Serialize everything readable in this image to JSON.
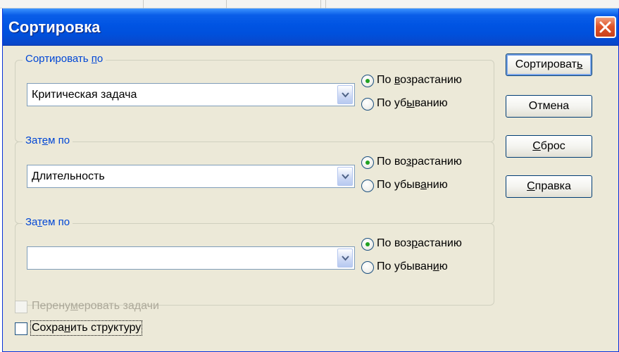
{
  "window": {
    "title": "Сортировка"
  },
  "groups": [
    {
      "label_parts": [
        "Сортировать ",
        "п",
        "о"
      ],
      "value": "Критическая задача",
      "asc_parts": [
        "По ",
        "в",
        "озрастанию"
      ],
      "desc_parts": [
        "По уб",
        "ы",
        "ванию"
      ],
      "selected": "asc"
    },
    {
      "label_parts": [
        "Зат",
        "е",
        "м по"
      ],
      "value": "Длительность",
      "asc_parts": [
        "По во",
        "з",
        "растанию"
      ],
      "desc_parts": [
        "По убыв",
        "а",
        "нию"
      ],
      "selected": "asc"
    },
    {
      "label_parts": [
        "За",
        "т",
        "ем по"
      ],
      "value": "",
      "asc_parts": [
        "По воз",
        "р",
        "астанию"
      ],
      "desc_parts": [
        "По убыван",
        "и",
        "ю"
      ],
      "selected": "asc"
    }
  ],
  "buttons": {
    "sort": [
      "Сортироват",
      "ь",
      ""
    ],
    "cancel": [
      "",
      "",
      "Отмена"
    ],
    "reset": [
      "",
      "С",
      "брос"
    ],
    "help": [
      "",
      "С",
      "правка"
    ]
  },
  "checkboxes": {
    "renumber": {
      "parts": [
        "Перену",
        "м",
        "еровать задачи"
      ],
      "checked": false,
      "enabled": false
    },
    "keep_outline": {
      "parts": [
        "Сохра",
        "н",
        "ить структуру"
      ],
      "checked": false,
      "enabled": true
    }
  },
  "colors": {
    "title_bar": "#0054e3",
    "group_label": "#0046d5",
    "dialog_bg": "#ece9d8",
    "radio_dot": "#21a121",
    "close_button": "#e0552a"
  },
  "icons": {
    "close": "close-icon",
    "dropdown": "chevron-down-icon"
  }
}
